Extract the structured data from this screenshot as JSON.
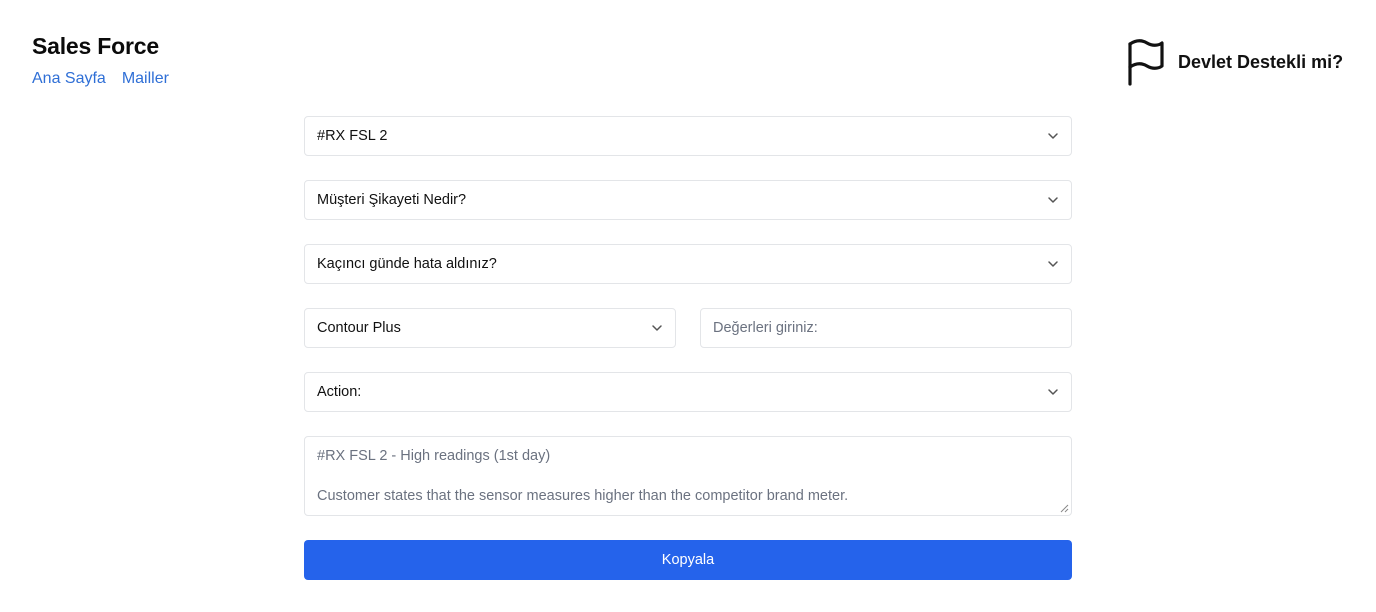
{
  "header": {
    "brand": "Sales Force",
    "nav": [
      {
        "label": "Ana Sayfa"
      },
      {
        "label": "Mailler"
      }
    ],
    "gov_toggle": {
      "label": "Devlet Destekli mi?",
      "icon": "flag-icon"
    }
  },
  "form": {
    "code_select": {
      "value": "#RX FSL 2"
    },
    "complaint_select": {
      "value": "Müşteri Şikayeti Nedir?"
    },
    "day_select": {
      "value": "Kaçıncı günde hata aldınız?"
    },
    "device_select": {
      "value": "Contour Plus"
    },
    "values_input": {
      "placeholder": "Değerleri giriniz:"
    },
    "action_select": {
      "value": "Action:"
    },
    "output": {
      "line1": "#RX FSL 2 - High readings (1st day)",
      "line2": "Customer states that the sensor measures higher than the competitor brand meter."
    },
    "copy_button": "Kopyala"
  }
}
